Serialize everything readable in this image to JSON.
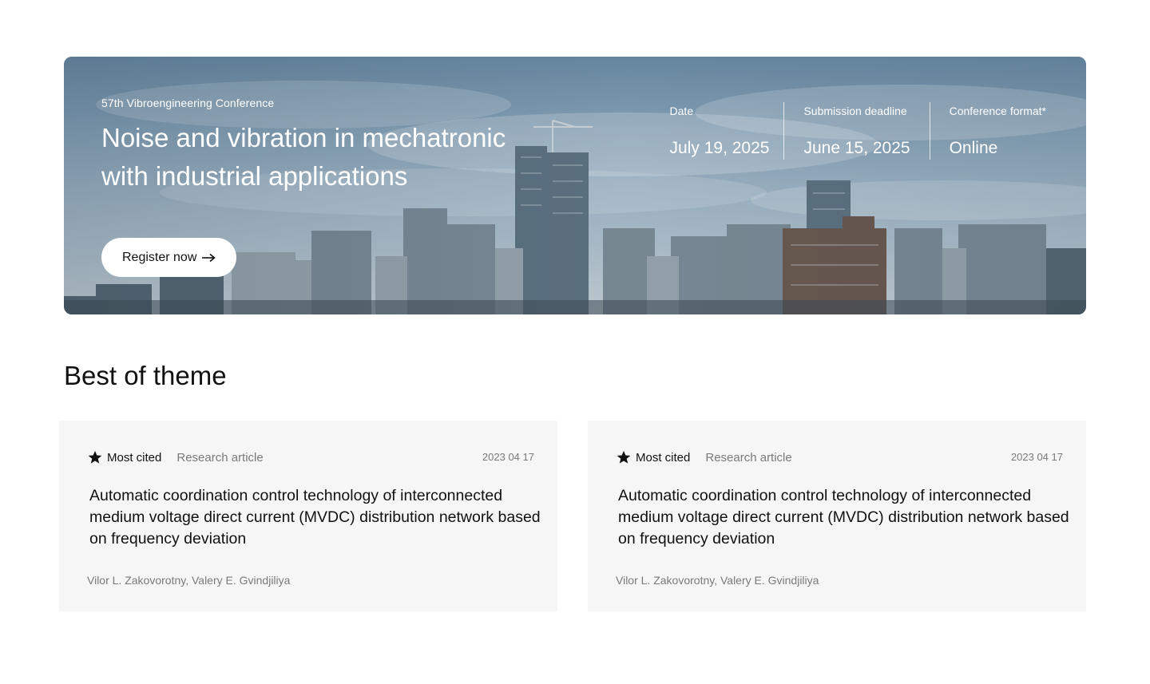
{
  "hero": {
    "eyebrow": "57th Vibroengineering Conference",
    "title": "Noise and vibration in mechatronic with industrial applications",
    "register_label": "Register now",
    "register_icon": "arrow-right-icon",
    "meta": [
      {
        "label": "Date",
        "value": "July 19, 2025"
      },
      {
        "label": "Submission deadline",
        "value": "June 15, 2025"
      },
      {
        "label": "Conference format*",
        "value": "Online"
      }
    ]
  },
  "section": {
    "title": "Best of theme"
  },
  "cards": [
    {
      "badge_icon": "star-icon",
      "badge": "Most cited",
      "type": "Research article",
      "date": "2023 04 17",
      "title": "Automatic coordination control technology of interconnected medium voltage direct current (MVDC) distribution network based on frequency deviation",
      "authors": "Vilor L. Zakovorotny, Valery E. Gvindjiliya"
    },
    {
      "badge_icon": "star-icon",
      "badge": "Most cited",
      "type": "Research article",
      "date": "2023 04 17",
      "title": "Automatic coordination control technology of interconnected medium voltage direct current (MVDC) distribution network based on frequency deviation",
      "authors": "Vilor L. Zakovorotny, Valery E. Gvindjiliya"
    }
  ]
}
